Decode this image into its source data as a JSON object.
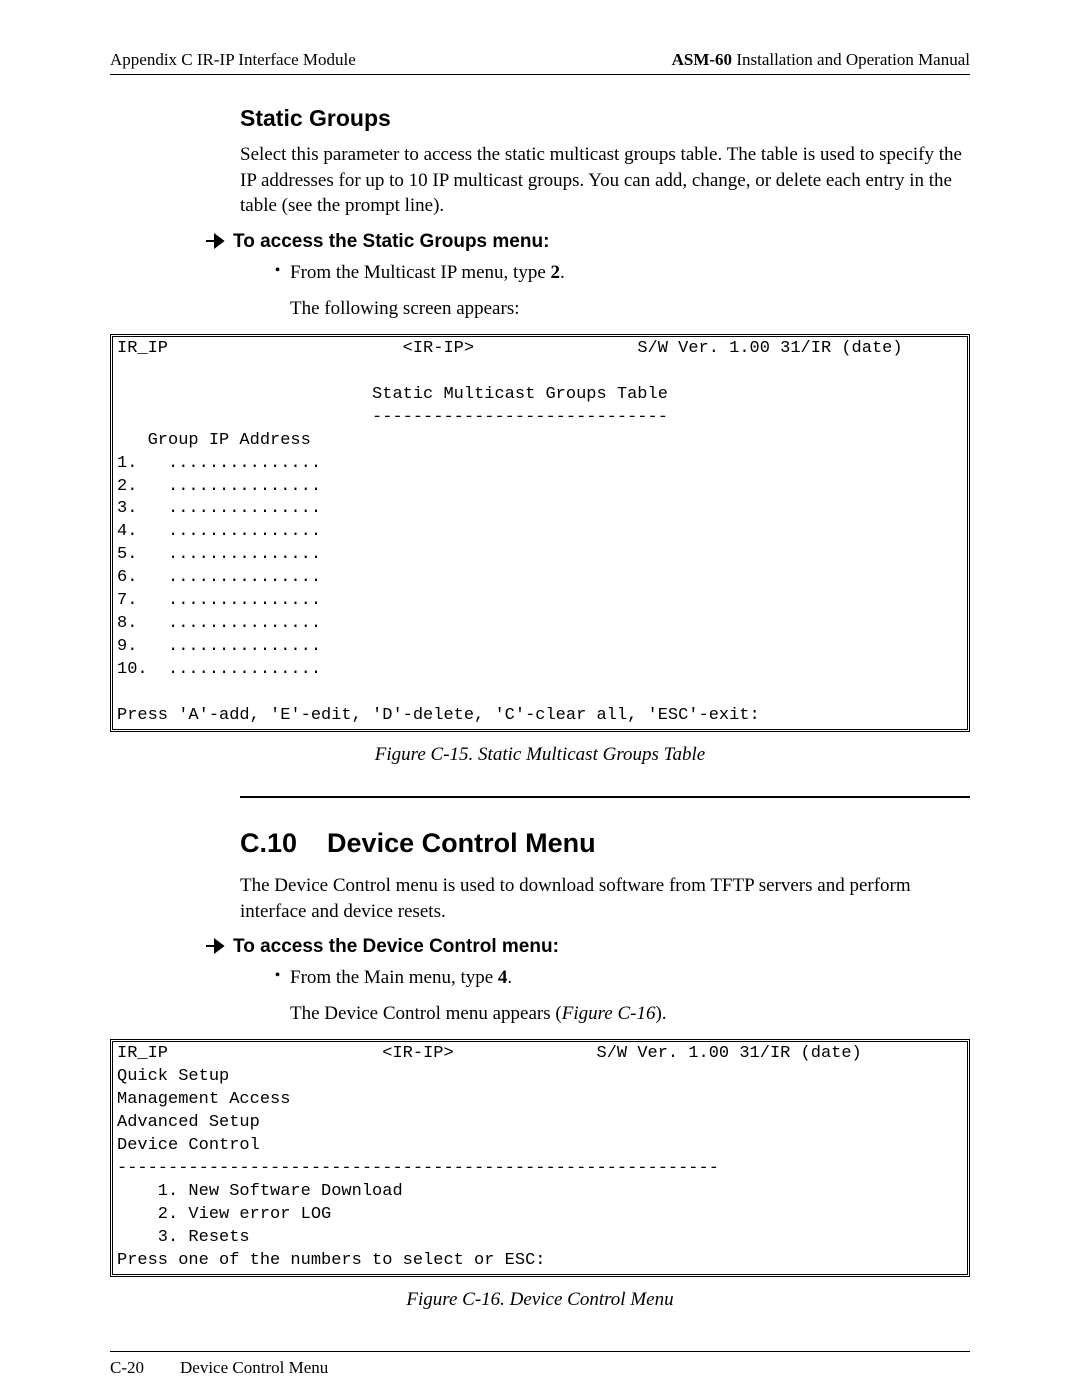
{
  "header": {
    "left": "Appendix C  IR-IP Interface Module",
    "right_bold": "ASM-60",
    "right_rest": " Installation and Operation Manual"
  },
  "static_groups": {
    "heading": "Static Groups",
    "paragraph": "Select this parameter to access the static multicast groups table. The table is used to specify the IP addresses for up to 10 IP multicast groups. You can add, change, or delete each entry in the table (see the prompt line).",
    "procedure_label": "To access the Static Groups menu:",
    "bullet_text_pre": "From the Multicast IP menu, type ",
    "bullet_text_key": "2",
    "bullet_text_post": ".",
    "result_text": "The following screen appears:"
  },
  "terminal1": {
    "hdr_left": "IR_IP",
    "hdr_mid": "<IR-IP>",
    "hdr_right": "S/W Ver. 1.00 31/IR (date)",
    "title": "Static Multicast Groups Table",
    "title_underline": "-----------------------------",
    "col_header": "   Group IP Address",
    "rows": [
      "1.   ...............",
      "2.   ...............",
      "3.   ...............",
      "4.   ...............",
      "5.   ...............",
      "6.   ...............",
      "7.   ...............",
      "8.   ...............",
      "9.   ...............",
      "10.  ..............."
    ],
    "prompt": "Press 'A'-add, 'E'-edit, 'D'-delete, 'C'-clear all, 'ESC'-exit:"
  },
  "caption1": "Figure C-15.  Static Multicast Groups Table",
  "section": {
    "number": "C.10",
    "title": "Device Control Menu",
    "paragraph": "The Device Control menu is used to download software from TFTP servers and perform interface and device resets.",
    "procedure_label": "To access the Device Control menu:",
    "bullet_text_pre": "From the Main menu, type ",
    "bullet_text_key": "4",
    "bullet_text_post": ".",
    "result_text_pre": "The Device Control menu appears (",
    "result_text_fig": "Figure C-16",
    "result_text_post": ")."
  },
  "terminal2": {
    "hdr_left": "IR_IP",
    "hdr_mid": "<IR-IP>",
    "hdr_right": "S/W Ver. 1.00 31/IR (date)",
    "menu_lines": [
      "Quick Setup",
      "Management Access",
      "Advanced Setup",
      "Device Control"
    ],
    "divider": "-----------------------------------------------------------",
    "options": [
      "    1. New Software Download",
      "    2. View error LOG",
      "    3. Resets"
    ],
    "prompt": "Press one of the numbers to select or ESC:"
  },
  "caption2": "Figure C-16.  Device Control Menu",
  "footer": {
    "page": "C-20",
    "text": "Device Control Menu"
  }
}
